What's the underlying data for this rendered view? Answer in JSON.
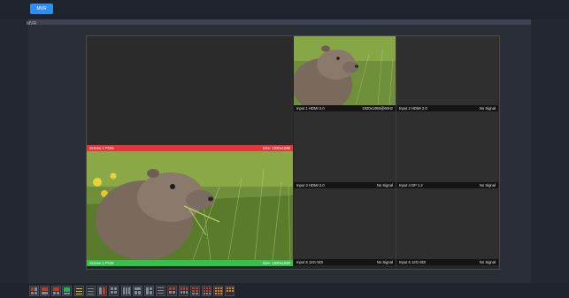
{
  "topbar": {
    "tab_label": "MVR"
  },
  "panel": {
    "label": "MVR"
  },
  "screens": {
    "pgm": {
      "name": "Screen 1 PGM",
      "size": "Size: 1920x1080",
      "color": "#e8353b"
    },
    "pvw": {
      "name": "Screen 1 PVW",
      "size": "Size: 1920x1080",
      "color": "#34c24a"
    }
  },
  "inputs": [
    {
      "name": "Input 1 HDMI 2.0",
      "status": "1920x1080@60Hz"
    },
    {
      "name": "Input 2 HDMI 2.0",
      "status": "No Signal"
    },
    {
      "name": "Input 3 HDMI 2.0",
      "status": "No Signal"
    },
    {
      "name": "Input 4 DP 1.2",
      "status": "No Signal"
    },
    {
      "name": "Input 5 12G-SDI",
      "status": "No Signal"
    },
    {
      "name": "Input 6 12G-SDI",
      "status": "No Signal"
    }
  ],
  "layout_presets": {
    "icons": [
      "layout-2x2-icon",
      "layout-1x2-icon",
      "layout-split-icon",
      "layout-stack-icon",
      "layout-3col-icon",
      "layout-quad-icon",
      "layout-6-icon",
      "layout-8-icon",
      "layout-9-icon",
      "layout-12-icon",
      "layout-16-icon",
      "layout-grid-icon"
    ],
    "accent": "#c0392b"
  }
}
